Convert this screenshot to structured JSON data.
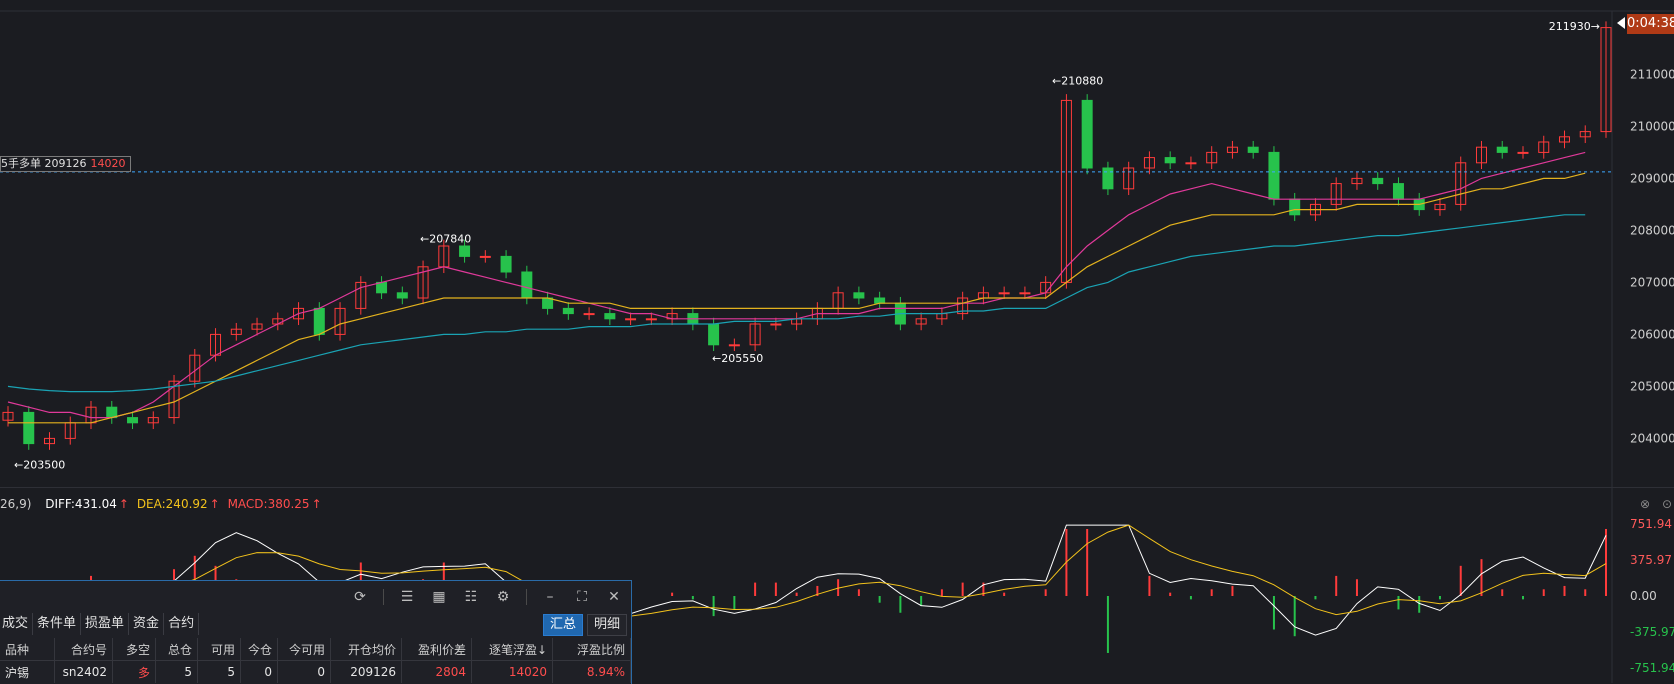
{
  "chart_data": [
    {
      "type": "candlestick",
      "y_axis_ticks": [
        204000,
        205000,
        206000,
        207000,
        208000,
        209000,
        210000,
        211000
      ],
      "ylim": [
        203200,
        212200
      ],
      "annotations": [
        {
          "label": "203500",
          "price": 203500
        },
        {
          "label": "207840",
          "price": 207840
        },
        {
          "label": "205550",
          "price": 205550
        },
        {
          "label": "210880",
          "price": 210880
        },
        {
          "label": "211930",
          "price": 211930
        }
      ],
      "last_price_line": 209126,
      "close_series": [
        204500,
        203900,
        204000,
        204300,
        204600,
        204400,
        204300,
        204400,
        205100,
        205600,
        206000,
        206100,
        206200,
        206300,
        206500,
        206000,
        206500,
        207000,
        206800,
        206700,
        207300,
        207700,
        207500,
        207500,
        207200,
        206700,
        206500,
        206400,
        206400,
        206300,
        206300,
        206300,
        206400,
        206200,
        205800,
        205800,
        206200,
        206200,
        206300,
        206500,
        206800,
        206700,
        206600,
        206200,
        206300,
        206400,
        206700,
        206800,
        206800,
        206800,
        207000,
        210500,
        209200,
        208800,
        209200,
        209400,
        209300,
        209300,
        209500,
        209600,
        209500,
        208600,
        208300,
        208500,
        208900,
        209000,
        208900,
        208600,
        208400,
        208500,
        209300,
        209600,
        209500,
        209500,
        209700,
        209800,
        209900,
        211900
      ],
      "ma_series": [
        {
          "color": "#e0399a",
          "values": [
            204700,
            204600,
            204500,
            204500,
            204400,
            204400,
            204500,
            204700,
            205000,
            205300,
            205600,
            205800,
            206000,
            206200,
            206400,
            206500,
            206700,
            206900,
            207000,
            207100,
            207200,
            207300,
            207200,
            207100,
            207000,
            206900,
            206800,
            206700,
            206600,
            206500,
            206400,
            206400,
            206300,
            206300,
            206300,
            206300,
            206300,
            206300,
            206300,
            206400,
            206400,
            206400,
            206500,
            206500,
            206500,
            206500,
            206600,
            206600,
            206700,
            206700,
            206800,
            207300,
            207700,
            208000,
            208300,
            208500,
            208700,
            208800,
            208900,
            208800,
            208700,
            208600,
            208600,
            208600,
            208600,
            208600,
            208600,
            208600,
            208600,
            208700,
            208800,
            209000,
            209100,
            209200,
            209300,
            209400,
            209500
          ]
        },
        {
          "color": "#e3b21e",
          "values": [
            204300,
            204300,
            204300,
            204300,
            204300,
            204400,
            204500,
            204600,
            204700,
            204900,
            205100,
            205300,
            205500,
            205700,
            205900,
            206000,
            206200,
            206300,
            206400,
            206500,
            206600,
            206700,
            206700,
            206700,
            206700,
            206700,
            206700,
            206600,
            206600,
            206600,
            206500,
            206500,
            206500,
            206500,
            206500,
            206500,
            206500,
            206500,
            206500,
            206500,
            206500,
            206500,
            206600,
            206600,
            206600,
            206600,
            206600,
            206700,
            206700,
            206700,
            206700,
            207000,
            207300,
            207500,
            207700,
            207900,
            208100,
            208200,
            208300,
            208300,
            208300,
            208300,
            208400,
            208400,
            208400,
            208500,
            208500,
            208500,
            208500,
            208600,
            208700,
            208800,
            208800,
            208900,
            209000,
            209000,
            209100
          ]
        },
        {
          "color": "#1aa3b4",
          "values": [
            205000,
            204950,
            204920,
            204900,
            204900,
            204900,
            204920,
            204950,
            205000,
            205050,
            205100,
            205200,
            205300,
            205400,
            205500,
            205600,
            205700,
            205800,
            205850,
            205900,
            205950,
            206000,
            206000,
            206050,
            206050,
            206100,
            206100,
            206100,
            206150,
            206150,
            206150,
            206200,
            206200,
            206200,
            206200,
            206250,
            206250,
            206250,
            206300,
            206300,
            206300,
            206350,
            206350,
            206400,
            206400,
            206400,
            206450,
            206450,
            206500,
            206500,
            206500,
            206700,
            206900,
            207000,
            207200,
            207300,
            207400,
            207500,
            207550,
            207600,
            207650,
            207700,
            207700,
            207750,
            207800,
            207850,
            207900,
            207900,
            207950,
            208000,
            208050,
            208100,
            208150,
            208200,
            208250,
            208300,
            208300
          ]
        }
      ]
    },
    {
      "type": "macd",
      "y_axis_ticks": [
        751.94,
        375.97,
        0.0,
        -375.97,
        -751.94
      ],
      "y_axis_labels": [
        "751.94",
        "375.97",
        "0.00",
        "-375.97",
        "-751.94"
      ],
      "diff": 431.04,
      "dea": 240.92,
      "macd": 380.25
    }
  ],
  "position_tag": {
    "text": "5手多单  209126",
    "pl": "14020"
  },
  "timer": "0:04:38",
  "macd_header": {
    "params": "26,9)",
    "diff": "DIFF:431.04",
    "dea": "DEA:240.92",
    "macd": "MACD:380.25",
    "arrow": "↑"
  },
  "panel": {
    "tabs": [
      "成交",
      "条件单",
      "损盈单",
      "资金",
      "合约"
    ],
    "view_buttons": [
      "汇总",
      "明细"
    ],
    "columns": [
      "品种",
      "合约号",
      "多空",
      "总仓",
      "可用",
      "今仓",
      "今可用",
      "开仓均价",
      "盈利价差",
      "逐笔浮盈↓",
      "浮盈比例"
    ],
    "rows": [
      [
        "沪锡",
        "sn2402",
        "多",
        "5",
        "5",
        "0",
        "0",
        "209126",
        "2804",
        "14020",
        "8.94%"
      ]
    ]
  }
}
